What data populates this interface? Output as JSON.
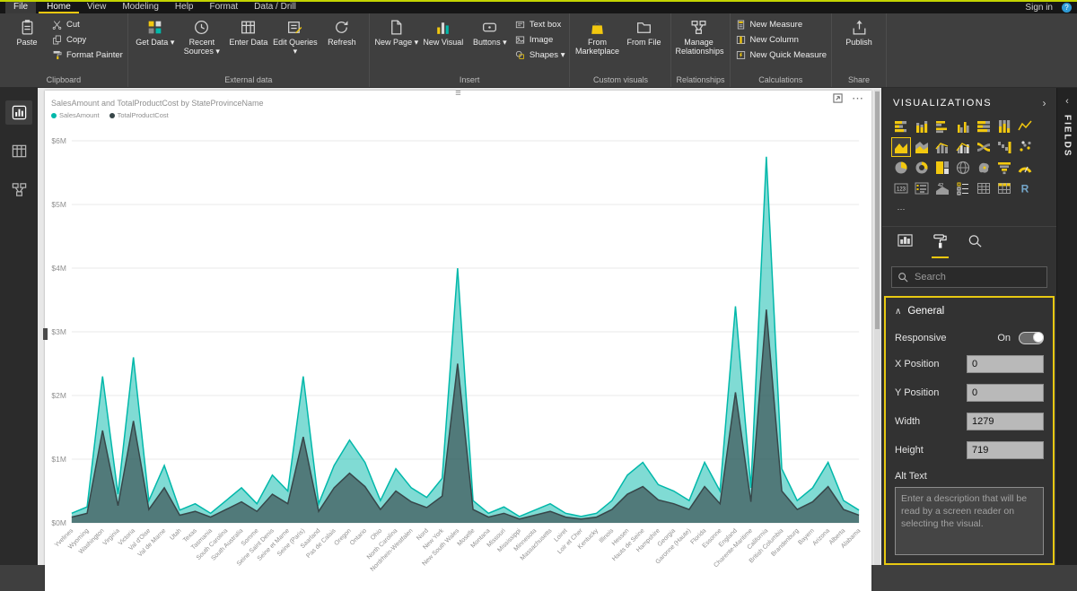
{
  "titlebar": {
    "tabs": [
      {
        "label": "File",
        "style": "file"
      },
      {
        "label": "Home",
        "active": true
      },
      {
        "label": "View"
      },
      {
        "label": "Modeling"
      },
      {
        "label": "Help"
      },
      {
        "label": "Format"
      },
      {
        "label": "Data / Drill"
      }
    ],
    "signin": "Sign in",
    "help": "?"
  },
  "ribbon": {
    "groups": [
      {
        "label": "Clipboard",
        "items": [
          {
            "kind": "large",
            "label": "Paste",
            "icon": "clipboard"
          },
          {
            "kind": "stack",
            "items": [
              {
                "label": "Cut",
                "icon": "scissors"
              },
              {
                "label": "Copy",
                "icon": "copy"
              },
              {
                "label": "Format Painter",
                "icon": "format-painter"
              }
            ]
          }
        ]
      },
      {
        "label": "External data",
        "items": [
          {
            "kind": "large",
            "label": "Get Data",
            "icon": "get-data",
            "dropdown": true
          },
          {
            "kind": "large",
            "label": "Recent Sources",
            "icon": "clock",
            "dropdown": true
          },
          {
            "kind": "large",
            "label": "Enter Data",
            "icon": "table-grid"
          },
          {
            "kind": "large",
            "label": "Edit Queries",
            "icon": "edit",
            "dropdown": true
          },
          {
            "kind": "large",
            "label": "Refresh",
            "icon": "refresh"
          }
        ]
      },
      {
        "label": "Insert",
        "items": [
          {
            "kind": "large",
            "label": "New Page",
            "icon": "page",
            "dropdown": true
          },
          {
            "kind": "large",
            "label": "New Visual",
            "icon": "new-visual"
          },
          {
            "kind": "large",
            "label": "Buttons",
            "icon": "buttons",
            "dropdown": true
          },
          {
            "kind": "stack",
            "items": [
              {
                "label": "Text box",
                "icon": "textbox"
              },
              {
                "label": "Image",
                "icon": "image"
              },
              {
                "label": "Shapes",
                "icon": "shapes",
                "dropdown": true
              }
            ]
          }
        ]
      },
      {
        "label": "Custom visuals",
        "items": [
          {
            "kind": "large",
            "label": "From Marketplace",
            "icon": "store"
          },
          {
            "kind": "large",
            "label": "From File",
            "icon": "file"
          }
        ]
      },
      {
        "label": "Relationships",
        "items": [
          {
            "kind": "large",
            "label": "Manage Relationships",
            "icon": "relationships"
          }
        ]
      },
      {
        "label": "Calculations",
        "items": [
          {
            "kind": "stack",
            "items": [
              {
                "label": "New Measure",
                "icon": "measure"
              },
              {
                "label": "New Column",
                "icon": "column"
              },
              {
                "label": "New Quick Measure",
                "icon": "quick-measure"
              }
            ]
          }
        ]
      },
      {
        "label": "Share",
        "items": [
          {
            "kind": "large",
            "label": "Publish",
            "icon": "publish"
          }
        ]
      }
    ]
  },
  "left_rail": {
    "items": [
      {
        "name": "report-view",
        "selected": true
      },
      {
        "name": "data-view"
      },
      {
        "name": "model-view"
      }
    ]
  },
  "canvas": {
    "grip": "≡",
    "more": "⋯"
  },
  "chart_data": {
    "type": "area",
    "title": "SalesAmount and TotalProductCost by StateProvinceName",
    "legend_position": "top-left",
    "grid": true,
    "ylim": [
      0,
      6
    ],
    "yticks": [
      "$0M",
      "$1M",
      "$2M",
      "$3M",
      "$4M",
      "$5M",
      "$6M"
    ],
    "xlabel": "",
    "ylabel": "",
    "categories": [
      "Yvelines",
      "Wyoming",
      "Washington",
      "Virginia",
      "Victoria",
      "Val d'Oise",
      "Val de Marne",
      "Utah",
      "Texas",
      "Tasmania",
      "South Carolina",
      "South Australia",
      "Somme",
      "Seine Saint Denis",
      "Seine et Marne",
      "Seine (Paris)",
      "Saarland",
      "Pas de Calais",
      "Oregon",
      "Ontario",
      "Ohio",
      "North Carolina",
      "Nordrhein-Westfalen",
      "Nord",
      "New York",
      "New South Wales",
      "Moselle",
      "Montana",
      "Missouri",
      "Mississippi",
      "Minnesota",
      "Massachusetts",
      "Loiret",
      "Loir et Cher",
      "Kentucky",
      "Illinois",
      "Hessen",
      "Hauts de Seine",
      "Hampshire",
      "Georgia",
      "Garonne (Haute)",
      "Florida",
      "Essonne",
      "England",
      "Charente-Maritime",
      "California",
      "British Columbia",
      "Brandenburg",
      "Bayern",
      "Arizona",
      "Alberta",
      "Alabama"
    ],
    "series": [
      {
        "name": "SalesAmount",
        "color": "#01B8AA",
        "values": [
          0.15,
          0.25,
          2.3,
          0.45,
          2.6,
          0.35,
          0.9,
          0.2,
          0.3,
          0.15,
          0.35,
          0.55,
          0.3,
          0.75,
          0.5,
          2.3,
          0.3,
          0.9,
          1.3,
          0.95,
          0.35,
          0.85,
          0.55,
          0.4,
          0.7,
          4.0,
          0.35,
          0.15,
          0.25,
          0.1,
          0.2,
          0.3,
          0.15,
          0.1,
          0.15,
          0.35,
          0.75,
          0.95,
          0.6,
          0.5,
          0.35,
          0.95,
          0.5,
          3.4,
          0.55,
          5.75,
          0.85,
          0.35,
          0.55,
          0.95,
          0.35,
          0.2
        ]
      },
      {
        "name": "TotalProductCost",
        "color": "#374649",
        "values": [
          0.09,
          0.15,
          1.45,
          0.27,
          1.6,
          0.21,
          0.55,
          0.12,
          0.18,
          0.09,
          0.21,
          0.33,
          0.18,
          0.45,
          0.3,
          1.35,
          0.18,
          0.55,
          0.78,
          0.57,
          0.21,
          0.5,
          0.33,
          0.24,
          0.42,
          2.5,
          0.21,
          0.09,
          0.15,
          0.06,
          0.12,
          0.18,
          0.09,
          0.06,
          0.09,
          0.21,
          0.45,
          0.57,
          0.36,
          0.3,
          0.21,
          0.57,
          0.3,
          2.05,
          0.33,
          3.35,
          0.5,
          0.21,
          0.33,
          0.57,
          0.21,
          0.12
        ]
      }
    ]
  },
  "visualizations": {
    "title": "VISUALIZATIONS",
    "collapse_icon": "›",
    "icons": [
      {
        "name": "stacked-bar"
      },
      {
        "name": "stacked-column"
      },
      {
        "name": "clustered-bar"
      },
      {
        "name": "clustered-column"
      },
      {
        "name": "100-stacked-bar"
      },
      {
        "name": "100-stacked-column"
      },
      {
        "name": "line"
      },
      {
        "name": "area",
        "selected": true
      },
      {
        "name": "stacked-area"
      },
      {
        "name": "line-stacked-column"
      },
      {
        "name": "line-clustered-column"
      },
      {
        "name": "ribbon"
      },
      {
        "name": "waterfall"
      },
      {
        "name": "scatter"
      },
      {
        "name": "pie"
      },
      {
        "name": "donut"
      },
      {
        "name": "treemap"
      },
      {
        "name": "map"
      },
      {
        "name": "filled-map"
      },
      {
        "name": "funnel"
      },
      {
        "name": "gauge"
      },
      {
        "name": "card"
      },
      {
        "name": "multi-row-card"
      },
      {
        "name": "kpi"
      },
      {
        "name": "slicer"
      },
      {
        "name": "table"
      },
      {
        "name": "matrix"
      },
      {
        "name": "r-script"
      },
      {
        "name": "ellipsis"
      }
    ],
    "tabs": [
      {
        "name": "fields"
      },
      {
        "name": "format",
        "selected": true
      },
      {
        "name": "analytics"
      }
    ],
    "search_placeholder": "Search"
  },
  "format": {
    "general": {
      "collapse_icon": "∧",
      "title": "General",
      "responsive": {
        "label": "Responsive",
        "value": "On",
        "on": true
      },
      "fields": [
        {
          "label": "X Position",
          "value": "0"
        },
        {
          "label": "Y Position",
          "value": "0"
        },
        {
          "label": "Width",
          "value": "1279"
        },
        {
          "label": "Height",
          "value": "719"
        }
      ],
      "alt_text": {
        "label": "Alt Text",
        "placeholder": "Enter a description that will be read by a screen reader on selecting the visual."
      }
    }
  },
  "fields_pane": {
    "title": "FIELDS",
    "expand_icon": "‹"
  }
}
